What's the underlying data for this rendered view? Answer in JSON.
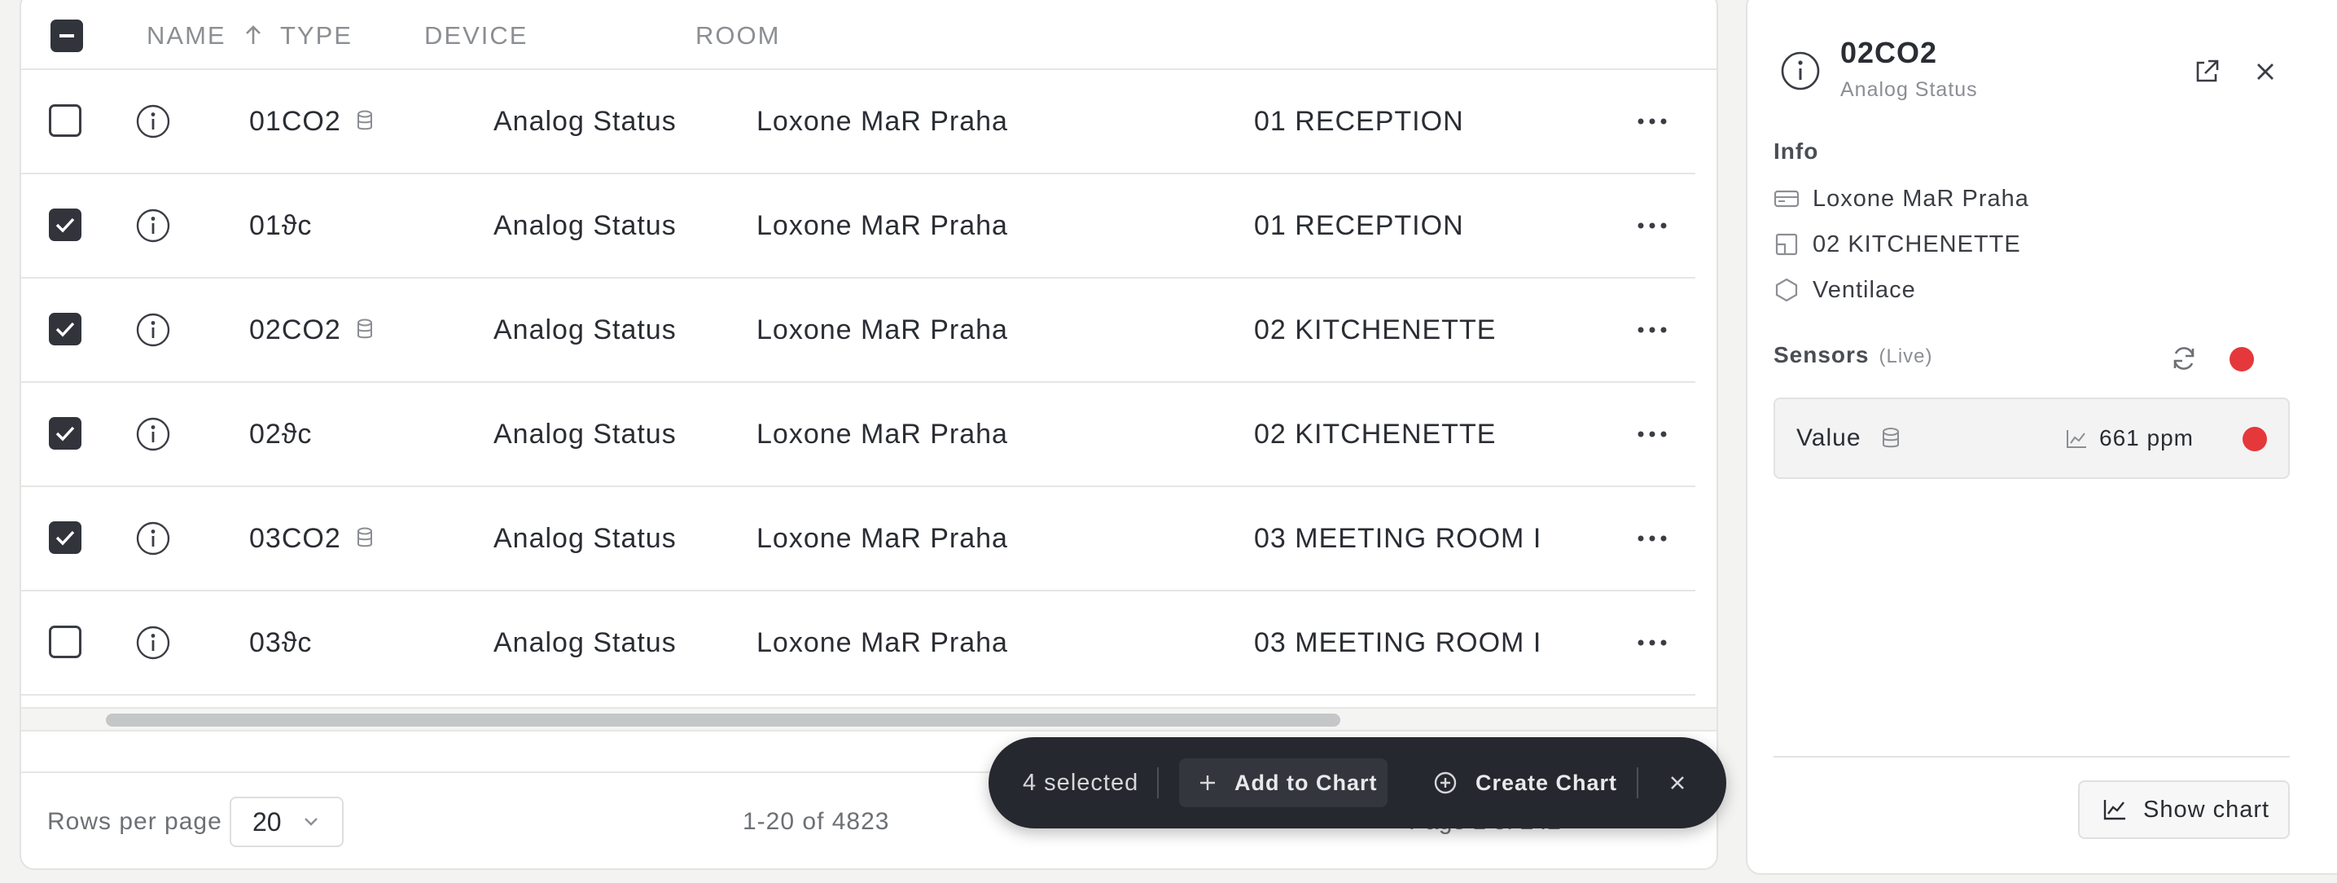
{
  "table": {
    "columns": {
      "name": "NAME",
      "type": "TYPE",
      "device": "DEVICE",
      "room": "ROOM"
    },
    "sort": {
      "column": "name",
      "direction": "asc"
    },
    "rows": [
      {
        "name": "01CO2",
        "has_db": true,
        "checked": false,
        "type": "Analog Status",
        "device": "Loxone MaR Praha",
        "room": "01 RECEPTION"
      },
      {
        "name": "01ϑc",
        "has_db": false,
        "checked": true,
        "type": "Analog Status",
        "device": "Loxone MaR Praha",
        "room": "01 RECEPTION"
      },
      {
        "name": "02CO2",
        "has_db": true,
        "checked": true,
        "type": "Analog Status",
        "device": "Loxone MaR Praha",
        "room": "02 KITCHENETTE"
      },
      {
        "name": "02ϑc",
        "has_db": false,
        "checked": true,
        "type": "Analog Status",
        "device": "Loxone MaR Praha",
        "room": "02 KITCHENETTE"
      },
      {
        "name": "03CO2",
        "has_db": true,
        "checked": true,
        "type": "Analog Status",
        "device": "Loxone MaR Praha",
        "room": "03 MEETING ROOM I"
      },
      {
        "name": "03ϑc",
        "has_db": false,
        "checked": false,
        "type": "Analog Status",
        "device": "Loxone MaR Praha",
        "room": "03 MEETING ROOM I"
      }
    ]
  },
  "footer": {
    "rows_per_page_label": "Rows per page",
    "rows_per_page_value": "20",
    "range": "1-20 of 4823",
    "page": "Page 1 of 242"
  },
  "selection_bar": {
    "count_label": "4 selected",
    "add_to_chart": "Add to Chart",
    "create_chart": "Create Chart"
  },
  "panel": {
    "title": "02CO2",
    "subtitle": "Analog Status",
    "info_heading": "Info",
    "info_items": {
      "device": "Loxone MaR Praha",
      "room": "02 KITCHENETTE",
      "category": "Ventilace"
    },
    "sensors_heading": "Sensors",
    "sensors_live": "(Live)",
    "sensor": {
      "name": "Value",
      "value": "661 ppm"
    },
    "show_chart": "Show chart"
  },
  "colors": {
    "status_red": "#e5383b",
    "dark": "#25282e",
    "checkbox": "#31343b"
  }
}
